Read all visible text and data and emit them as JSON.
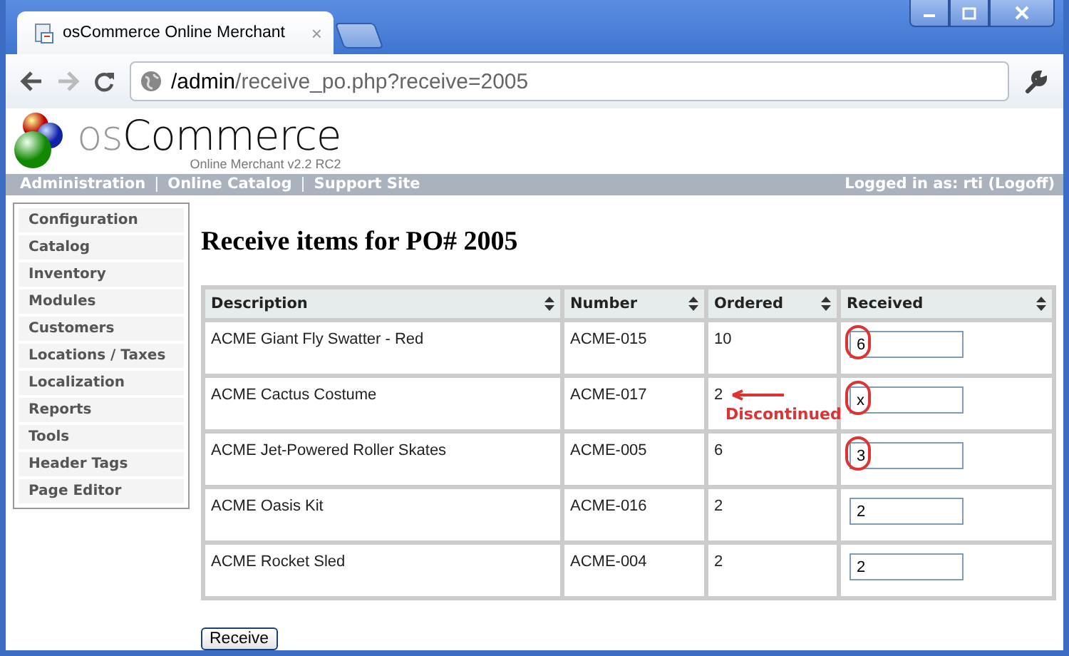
{
  "browser": {
    "tab_title": "osCommerce Online Merchant",
    "tab_close": "×",
    "url_host_part": "/admin",
    "url_rest": "/receive_po.php?receive=2005"
  },
  "logo": {
    "prefix": "os",
    "name": "Commerce",
    "subtitle": "Online Merchant v2.2 RC2"
  },
  "nav": {
    "links": [
      "Administration",
      "Online Catalog",
      "Support Site"
    ],
    "separator": "|",
    "login": "Logged in as: rti (Logoff)"
  },
  "sidebar": {
    "items": [
      "Configuration",
      "Catalog",
      "Inventory",
      "Modules",
      "Customers",
      "Locations / Taxes",
      "Localization",
      "Reports",
      "Tools",
      "Header Tags",
      "Page Editor"
    ]
  },
  "heading": "Receive items for PO# 2005",
  "table": {
    "columns": [
      "Description",
      "Number",
      "Ordered",
      "Received"
    ],
    "rows": [
      {
        "description": "ACME Giant Fly Swatter - Red",
        "number": "ACME-015",
        "ordered": "10",
        "received": "6",
        "circled": true
      },
      {
        "description": "ACME Cactus Costume",
        "number": "ACME-017",
        "ordered": "2",
        "received": "x",
        "circled": true,
        "annotation": "Discontinued"
      },
      {
        "description": "ACME Jet-Powered Roller Skates",
        "number": "ACME-005",
        "ordered": "6",
        "received": "3",
        "circled": true
      },
      {
        "description": "ACME Oasis Kit",
        "number": "ACME-016",
        "ordered": "2",
        "received": "2",
        "circled": false
      },
      {
        "description": "ACME Rocket Sled",
        "number": "ACME-004",
        "ordered": "2",
        "received": "2",
        "circled": false
      }
    ]
  },
  "submit": "Receive"
}
